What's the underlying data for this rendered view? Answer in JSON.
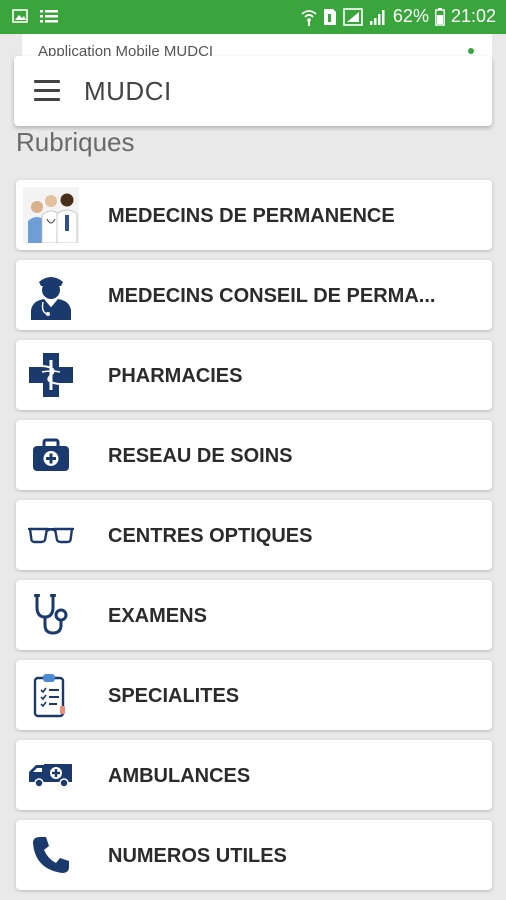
{
  "status_bar": {
    "battery_percent": "62%",
    "time": "21:02",
    "color": "#3aa53c"
  },
  "underlay": {
    "text": "Application Mobile MUDCI"
  },
  "app_bar": {
    "title": "MUDCI",
    "menu_icon": "hamburger-icon"
  },
  "section_title": "Rubriques",
  "rubriques": [
    {
      "label": "MEDECINS DE PERMANENCE",
      "icon": "doctors-photo-icon"
    },
    {
      "label": "MEDECINS CONSEIL DE PERMA...",
      "icon": "doctor-avatar-icon"
    },
    {
      "label": "PHARMACIES",
      "icon": "pharmacy-cross-icon"
    },
    {
      "label": "RESEAU DE SOINS",
      "icon": "medical-kit-icon"
    },
    {
      "label": "CENTRES OPTIQUES",
      "icon": "glasses-icon"
    },
    {
      "label": "EXAMENS",
      "icon": "stethoscope-icon"
    },
    {
      "label": "SPECIALITES",
      "icon": "clipboard-icon"
    },
    {
      "label": "AMBULANCES",
      "icon": "ambulance-icon"
    },
    {
      "label": "NUMEROS UTILES",
      "icon": "phone-icon"
    }
  ],
  "colors": {
    "icon_navy": "#1a3a6e",
    "accent": "#3aa53c"
  }
}
